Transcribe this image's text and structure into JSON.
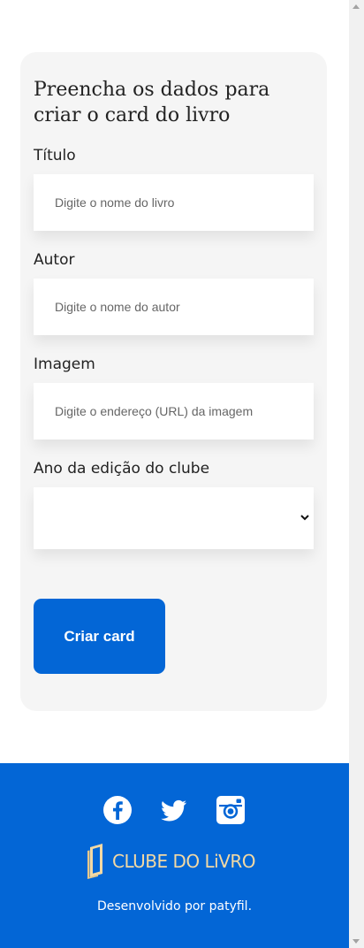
{
  "form": {
    "title": "Preencha os dados para criar o card do livro",
    "fields": [
      {
        "label": "Título",
        "placeholder": "Digite o nome do livro"
      },
      {
        "label": "Autor",
        "placeholder": "Digite o nome do autor"
      },
      {
        "label": "Imagem",
        "placeholder": "Digite o endereço (URL) da imagem"
      },
      {
        "label": "Ano da edição do clube",
        "selected_value": ""
      }
    ],
    "submit_label": "Criar card"
  },
  "footer": {
    "social_icons": [
      "facebook-icon",
      "twitter-icon",
      "instagram-icon"
    ],
    "brand": "CLUBE DO LiVRO",
    "credit": "Desenvolvido por patyfil."
  },
  "colors": {
    "primary": "#0366d6",
    "card_background": "#f5f5f5",
    "brand_gold": "#f3d9a4"
  }
}
